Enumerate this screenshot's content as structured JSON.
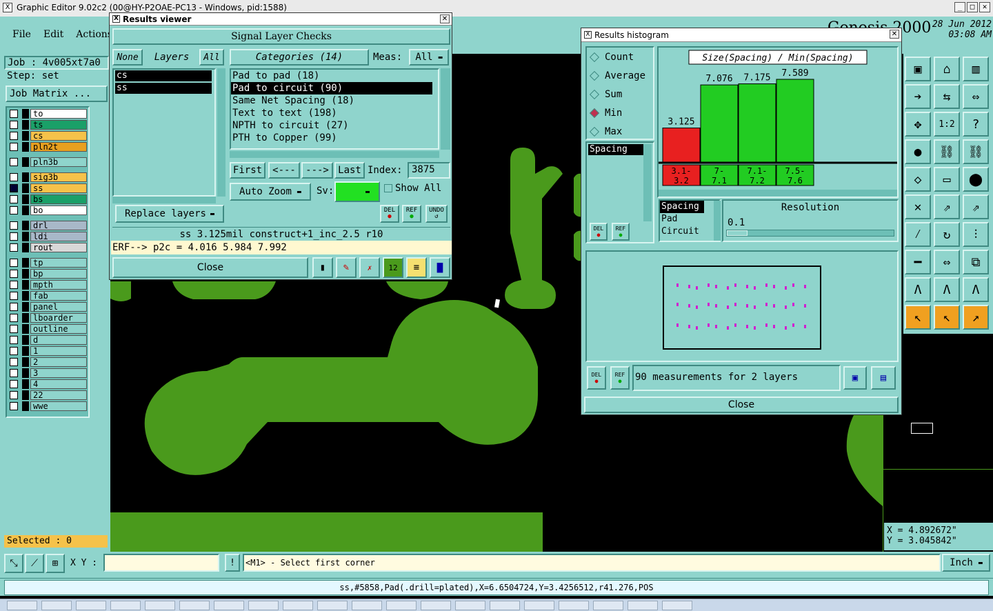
{
  "app": {
    "title": "Graphic Editor 9.02c2 (00@HY-P2OAE-PC13 - Windows, pid:1588)",
    "brand": "Genesis 2000",
    "date": "28 Jun 2012",
    "time": "03:08 AM",
    "menu": [
      "File",
      "Edit",
      "Actions"
    ]
  },
  "left": {
    "job": "Job : 4v005xt7a0",
    "step": "Step: set",
    "job_matrix": "Job Matrix ...",
    "selected": "Selected : 0",
    "layers": [
      {
        "name": "to",
        "color": "#ffffff"
      },
      {
        "name": "ts",
        "color": "#1aa068"
      },
      {
        "name": "cs",
        "color": "#f5c24a"
      },
      {
        "name": "pln2t",
        "color": "#e8a020"
      },
      {
        "name": "pln3b",
        "color": "#8fd4cc"
      },
      {
        "name": "sig3b",
        "color": "#f5c24a"
      },
      {
        "name": "ss",
        "color": "#f5c24a"
      },
      {
        "name": "bs",
        "color": "#1aa068"
      },
      {
        "name": "bo",
        "color": "#ffffff"
      },
      {
        "name": "drl",
        "color": "#a8b8c8"
      },
      {
        "name": "ldi",
        "color": "#a8b8c8"
      },
      {
        "name": "rout",
        "color": "#d8d8d8"
      },
      {
        "name": "tp",
        "color": "#8fd4cc"
      },
      {
        "name": "bp",
        "color": "#8fd4cc"
      },
      {
        "name": "mpth",
        "color": "#8fd4cc"
      },
      {
        "name": "fab",
        "color": "#8fd4cc"
      },
      {
        "name": "panel",
        "color": "#8fd4cc"
      },
      {
        "name": "lboarder",
        "color": "#8fd4cc"
      },
      {
        "name": "outline",
        "color": "#8fd4cc"
      },
      {
        "name": "d",
        "color": "#8fd4cc"
      },
      {
        "name": "1",
        "color": "#8fd4cc"
      },
      {
        "name": "2",
        "color": "#8fd4cc"
      },
      {
        "name": "3",
        "color": "#8fd4cc"
      },
      {
        "name": "4",
        "color": "#8fd4cc"
      },
      {
        "name": "22",
        "color": "#8fd4cc"
      },
      {
        "name": "wwe",
        "color": "#8fd4cc"
      }
    ]
  },
  "results_viewer": {
    "title": "Results viewer",
    "heading": "Signal Layer Checks",
    "none": "None",
    "layers_label": "Layers",
    "all": "All",
    "layer_list": [
      "cs",
      "ss"
    ],
    "categories": "Categories (14)",
    "meas_label": "Meas:",
    "meas_value": "All",
    "category_items": [
      "Pad to pad (18)",
      "Pad to circuit (90)",
      "Same Net Spacing (18)",
      "Text to text (198)",
      "NPTH to circuit (27)",
      "PTH to Copper (99)"
    ],
    "first": "First",
    "prev": "<---",
    "next": "--->",
    "last": "Last",
    "index_label": "Index:",
    "index_value": "3875",
    "auto_zoom": "Auto Zoom",
    "sv_label": "Sv:",
    "show_all": "Show All",
    "replace_layers": "Replace layers",
    "del": "DEL",
    "ref": "REF",
    "undo": "UNDO",
    "info": "ss 3.125mil  construct+1_inc_2.5  r10",
    "erf": "ERF--> p2c = 4.016 5.984 7.992",
    "close": "Close"
  },
  "histogram": {
    "title": "Results histogram",
    "modes": [
      "Count",
      "Average",
      "Sum",
      "Min",
      "Max"
    ],
    "selected_mode": "Min",
    "chart_title": "Size(Spacing) / Min(Spacing)",
    "spacing_item": "Spacing",
    "list": [
      "Spacing",
      "Pad",
      "Circuit"
    ],
    "resolution_label": "Resolution",
    "resolution_value": "0.1",
    "measurements": "90 measurements for 2 layers",
    "close": "Close",
    "del": "DEL",
    "ref": "REF"
  },
  "chart_data": {
    "type": "bar",
    "title": "Size(Spacing) / Min(Spacing)",
    "categories": [
      "3.1-3.2",
      "7-7.1",
      "7.1-7.2",
      "7.5-7.6"
    ],
    "values": [
      3.125,
      7.076,
      7.175,
      7.589
    ],
    "colors": [
      "#e82020",
      "#22cc22",
      "#22cc22",
      "#22cc22"
    ]
  },
  "bottom": {
    "xy_label": "X Y :",
    "xy_value": "",
    "prompt": "<M1> - Select first corner",
    "units": "Inch",
    "status": "ss,#5858,Pad(.drill=plated),X=6.6504724,Y=3.4256512,r41.276,POS",
    "coord_x": "X  =  4.892672\"",
    "coord_y": "Y  =  3.045842\""
  }
}
